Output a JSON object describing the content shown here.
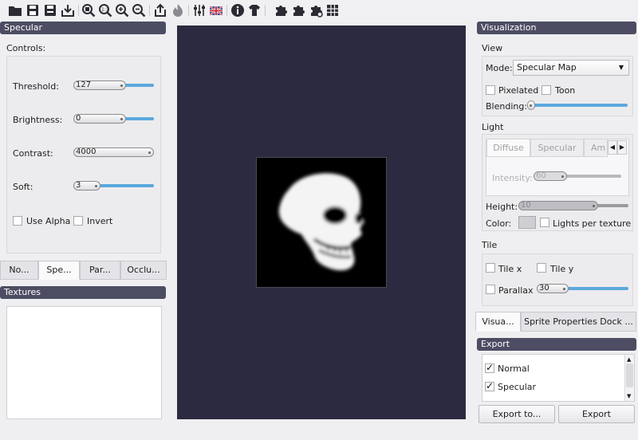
{
  "toolbar": {
    "icons": [
      "open-folder-icon",
      "save-icon",
      "save-as-icon",
      "export-icon",
      "zoom-fit-icon",
      "zoom-reset-icon",
      "zoom-in-icon",
      "zoom-out-icon",
      "share-icon",
      "flame-icon",
      "sliders-icon",
      "uk-flag-icon",
      "info-icon",
      "shirt-icon",
      "puzzle-icon",
      "puzzle-plus-icon",
      "puzzle-settings-icon",
      "grid-icon"
    ]
  },
  "specular": {
    "header": "Specular",
    "controls_label": "Controls:",
    "threshold": {
      "label": "Threshold:",
      "value": "127",
      "level": 0.5
    },
    "brightness": {
      "label": "Brightness:",
      "value": "0",
      "level": 0.5
    },
    "contrast": {
      "label": "Contrast:",
      "value": "4000",
      "level": 0.99
    },
    "soft": {
      "label": "Soft:",
      "value": "3",
      "level": 0.3
    },
    "use_alpha": {
      "label": "Use Alpha",
      "checked": false
    },
    "invert": {
      "label": "Invert",
      "checked": false
    }
  },
  "left_tabs": [
    "No...",
    "Spe...",
    "Par...",
    "Occlu..."
  ],
  "textures": {
    "header": "Textures"
  },
  "visualization": {
    "header": "Visualization",
    "view_label": "View",
    "mode_label": "Mode:",
    "mode_value": "Specular Map",
    "pixelated": {
      "label": "Pixelated",
      "checked": false
    },
    "toon": {
      "label": "Toon",
      "checked": false
    },
    "blending_label": "Blending:",
    "blending_level": 0.0
  },
  "light": {
    "label": "Light",
    "tabs": [
      "Diffuse",
      "Specular",
      "Am"
    ],
    "intensity_label": "Intensity:",
    "intensity_value": "60",
    "height_label": "Height:",
    "height_value": "10",
    "color_label": "Color:",
    "lights_per_texture": {
      "label": "Lights per texture",
      "checked": false
    }
  },
  "tile": {
    "label": "Tile",
    "tile_x": {
      "label": "Tile x",
      "checked": false
    },
    "tile_y": {
      "label": "Tile y",
      "checked": false
    },
    "parallax": {
      "label": "Parallax",
      "checked": false,
      "value": "30",
      "level": 0.3
    }
  },
  "right_tabs": [
    "Visua...",
    "Sprite Properties Dock ..."
  ],
  "export": {
    "header": "Export",
    "items": [
      {
        "label": "Normal",
        "checked": true
      },
      {
        "label": "Specular",
        "checked": true
      }
    ],
    "export_to_label": "Export to...",
    "export_label": "Export"
  },
  "colors": {
    "header_bg": "#4c4d63",
    "canvas_bg": "#2c2a40",
    "accent": "#5ba9dd"
  }
}
